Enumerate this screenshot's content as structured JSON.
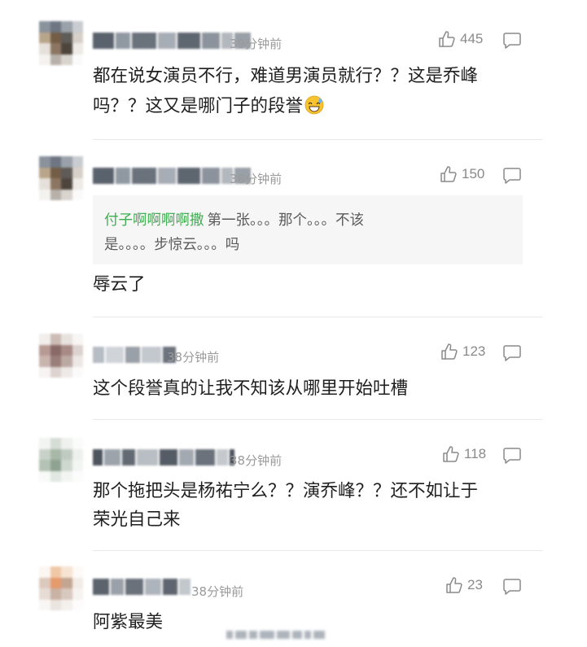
{
  "comments": [
    {
      "time": "39分钟前",
      "likes": "445",
      "text_lines": [
        "都在说女演员不行，难道男演员就行？？这是乔峰",
        "吗？？这又是哪门子的段誉"
      ],
      "emoji": "sweat-smile"
    },
    {
      "time": "38分钟前",
      "likes": "150",
      "quote": {
        "author": "付子啊啊啊啊撒",
        "line1": "第一张。。。那个。。。不该",
        "line2": "是。。。。步惊云。。。吗"
      },
      "text_lines": [
        "辱云了"
      ]
    },
    {
      "time": "38分钟前",
      "likes": "123",
      "text_lines": [
        "这个段誉真的让我不知该从哪里开始吐槽"
      ]
    },
    {
      "time": "38分钟前",
      "likes": "118",
      "text_lines": [
        "那个拖把头是杨祐宁么？？演乔峰？？还不如让于",
        "荣光自己来"
      ]
    },
    {
      "time": "38分钟前",
      "likes": "23",
      "text_lines": [
        "阿紫最美"
      ]
    }
  ],
  "icons": {
    "like": "thumbs-up-outline-icon",
    "reply": "comment-bubble-icon"
  },
  "colors": {
    "accent_green": "#3fae51",
    "muted_gray": "#9a9a9a",
    "text": "#1f1f1f"
  }
}
